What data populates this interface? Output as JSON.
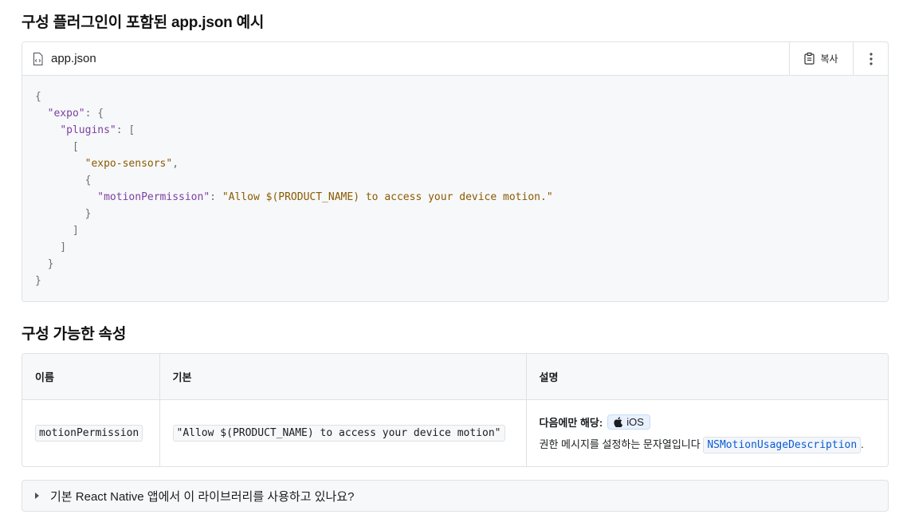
{
  "example": {
    "heading": "구성 플러그인이 포함된 app.json 예시",
    "file_name": "app.json",
    "copy_label": "복사",
    "file_icon": "file-code-icon",
    "copy_icon": "clipboard-icon",
    "more_icon": "more-vertical-icon"
  },
  "code_lines": [
    [
      "{"
    ],
    [
      "  ",
      {
        "k": "\"expo\""
      },
      ": {"
    ],
    [
      "    ",
      {
        "k": "\"plugins\""
      },
      ": ["
    ],
    [
      "      ["
    ],
    [
      "        ",
      {
        "s": "\"expo-sensors\""
      },
      ","
    ],
    [
      "        {"
    ],
    [
      "          ",
      {
        "k": "\"motionPermission\""
      },
      ": ",
      {
        "s": "\"Allow $(PRODUCT_NAME) to access your device motion.\""
      }
    ],
    [
      "        }"
    ],
    [
      "      ]"
    ],
    [
      "    ]"
    ],
    [
      "  }"
    ],
    [
      "}"
    ]
  ],
  "properties": {
    "heading": "구성 가능한 속성",
    "columns": [
      "이름",
      "기본",
      "설명"
    ],
    "rows": [
      {
        "name": "motionPermission",
        "default": "\"Allow $(PRODUCT_NAME) to access your device motion\"",
        "platform_label": "다음에만 해당:",
        "platform": "iOS",
        "platform_icon": "apple-icon",
        "desc_prefix": "권한 메시지를 설정하는 문자열입니다",
        "desc_code": "NSMotionUsageDescription",
        "desc_suffix": "."
      }
    ]
  },
  "collapsible": {
    "label": "기본 React Native 앱에서 이 라이브러리를 사용하고 있나요?",
    "icon": "caret-right-icon"
  },
  "colors": {
    "key": "#7b3fa3",
    "string": "#8a5a00",
    "link": "#0b5bd3",
    "border": "#dfe1e5",
    "code_bg": "#f7f8f9"
  }
}
